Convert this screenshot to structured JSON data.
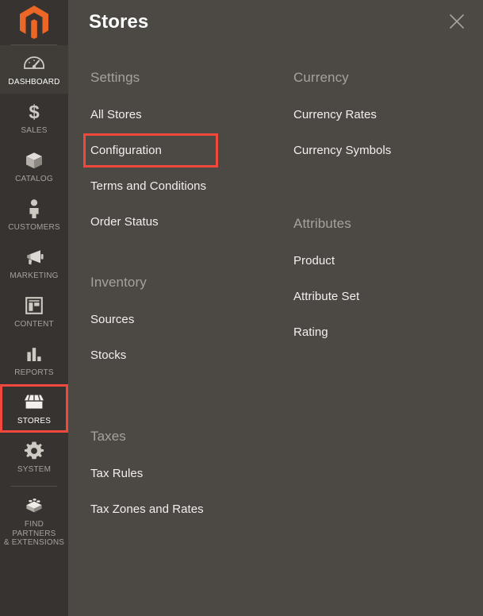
{
  "sidebar": {
    "logo": {
      "icon": "magento-logo-icon",
      "color": "#ec6625"
    },
    "items": [
      {
        "id": "dashboard",
        "label": "DASHBOARD",
        "icon": "gauge-icon",
        "state": "active"
      },
      {
        "id": "sales",
        "label": "SALES",
        "icon": "dollar-icon",
        "state": "normal"
      },
      {
        "id": "catalog",
        "label": "CATALOG",
        "icon": "box-icon",
        "state": "normal"
      },
      {
        "id": "customers",
        "label": "CUSTOMERS",
        "icon": "person-icon",
        "state": "normal"
      },
      {
        "id": "marketing",
        "label": "MARKETING",
        "icon": "megaphone-icon",
        "state": "normal"
      },
      {
        "id": "content",
        "label": "CONTENT",
        "icon": "layout-icon",
        "state": "normal"
      },
      {
        "id": "reports",
        "label": "REPORTS",
        "icon": "bar-chart-icon",
        "state": "normal"
      },
      {
        "id": "stores",
        "label": "STORES",
        "icon": "storefront-icon",
        "state": "highlighted"
      },
      {
        "id": "system",
        "label": "SYSTEM",
        "icon": "gear-icon",
        "state": "normal"
      },
      {
        "id": "find-partners",
        "label": "FIND PARTNERS\n& EXTENSIONS",
        "icon": "brick-icon",
        "state": "normal"
      }
    ]
  },
  "panel": {
    "title": "Stores",
    "close_icon": "close-icon",
    "highlight_color": "#f0483c",
    "columns": [
      {
        "id": "left",
        "groups": [
          {
            "id": "settings",
            "title": "Settings",
            "links": [
              {
                "id": "all-stores",
                "label": "All Stores",
                "highlighted": false
              },
              {
                "id": "configuration",
                "label": "Configuration",
                "highlighted": true
              },
              {
                "id": "terms-and-conditions",
                "label": "Terms and Conditions",
                "highlighted": false
              },
              {
                "id": "order-status",
                "label": "Order Status",
                "highlighted": false
              }
            ]
          },
          {
            "id": "inventory",
            "title": "Inventory",
            "links": [
              {
                "id": "sources",
                "label": "Sources",
                "highlighted": false
              },
              {
                "id": "stocks",
                "label": "Stocks",
                "highlighted": false
              }
            ]
          },
          {
            "id": "taxes",
            "title": "Taxes",
            "links": [
              {
                "id": "tax-rules",
                "label": "Tax Rules",
                "highlighted": false
              },
              {
                "id": "tax-zones-and-rates",
                "label": "Tax Zones and Rates",
                "highlighted": false
              }
            ]
          }
        ]
      },
      {
        "id": "right",
        "groups": [
          {
            "id": "currency",
            "title": "Currency",
            "links": [
              {
                "id": "currency-rates",
                "label": "Currency Rates",
                "highlighted": false
              },
              {
                "id": "currency-symbols",
                "label": "Currency Symbols",
                "highlighted": false
              }
            ]
          },
          {
            "id": "attributes",
            "title": "Attributes",
            "links": [
              {
                "id": "product",
                "label": "Product",
                "highlighted": false
              },
              {
                "id": "attribute-set",
                "label": "Attribute Set",
                "highlighted": false
              },
              {
                "id": "rating",
                "label": "Rating",
                "highlighted": false
              }
            ]
          }
        ]
      }
    ]
  }
}
